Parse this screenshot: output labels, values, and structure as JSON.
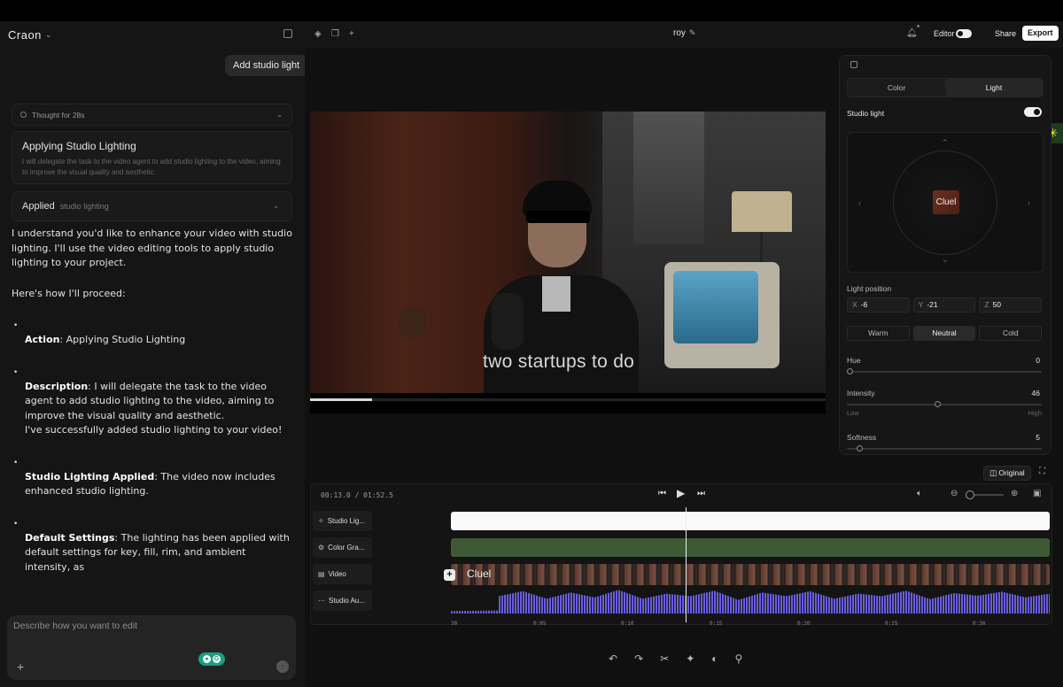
{
  "app": {
    "brand": "Craon",
    "project_name": "roy"
  },
  "header": {
    "editor_label": "Editor",
    "share_label": "Share",
    "export_label": "Export"
  },
  "chat": {
    "user_message": "Add studio light",
    "thought_label": "Thought for 28s",
    "task_title": "Applying Studio Lighting",
    "task_desc": "I will delegate the task to the video agent to add studio lighting to the video, aiming to improve the visual quality and aesthetic.",
    "applied_label": "Applied",
    "applied_detail": "studio lighting",
    "intro": "I understand you'd like to enhance your video with studio lighting. I'll use the video editing tools to apply studio lighting to your project.",
    "proceed": "Here's how I'll proceed:",
    "items": [
      {
        "title": "Action",
        "text": ": Applying Studio Lighting"
      },
      {
        "title": "Description",
        "text": ": I will delegate the task to the video agent to add studio lighting to the video, aiming to improve the visual quality and aesthetic."
      },
      {
        "title": "Studio Lighting Applied",
        "text": ": The video now includes enhanced studio lighting."
      },
      {
        "title": "Default Settings",
        "text": ": The lighting has been applied with default settings for key, fill, rim, and ambient intensity, as"
      }
    ],
    "success": "I've successfully added studio lighting to your video!",
    "input_placeholder": "Describe how you want to edit"
  },
  "video": {
    "subtitle": "two startups to do",
    "progress": 0.12
  },
  "light_panel": {
    "tabs": [
      "Color",
      "Light"
    ],
    "active_tab": "Light",
    "studio_light_label": "Studio light",
    "studio_light_on": true,
    "thumb_text": "Cluel",
    "position_label": "Light position",
    "position": [
      {
        "axis": "X",
        "value": "-6"
      },
      {
        "axis": "Y",
        "value": "-21"
      },
      {
        "axis": "Z",
        "value": "50"
      }
    ],
    "temps": [
      "Warm",
      "Neutral",
      "Cold"
    ],
    "active_temp": "Neutral",
    "hue": {
      "label": "Hue",
      "value": "0",
      "fraction": 0.0
    },
    "intensity": {
      "label": "Intensity",
      "value": "46",
      "fraction": 0.46,
      "low": "Low",
      "high": "High"
    },
    "softness": {
      "label": "Softness",
      "value": "5",
      "fraction": 0.05
    }
  },
  "viewer": {
    "original_label": "Original"
  },
  "timeline": {
    "timecode": "00:13.0 / 01:52.5",
    "tracks": [
      "Studio Lig...",
      "Color Gra...",
      "Video",
      "Studio Au..."
    ],
    "video_clip_label": "Cluel",
    "ruler": [
      "30",
      "0:05",
      "0:10",
      "0:15",
      "0:20",
      "0:25",
      "0:30"
    ]
  }
}
